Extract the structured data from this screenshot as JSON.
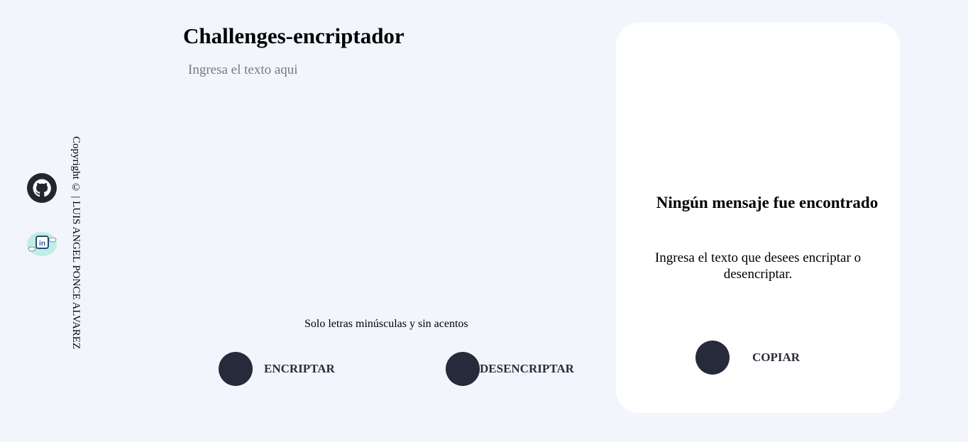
{
  "app": {
    "title": "Challenges-encriptador"
  },
  "sidebar": {
    "github_icon": "github-icon",
    "linkedin_icon": "linkedin-icon",
    "copyright": "Copyright © | LUIS ANGEL PONCE ALVAREZ"
  },
  "main": {
    "input_placeholder": "Ingresa el texto aqui",
    "input_value": "",
    "hint": "Solo letras minúsculas y sin acentos",
    "encrypt_label": "ENCRIPTAR",
    "decrypt_label": "DESENCRIPTAR"
  },
  "result": {
    "title": "Ningún mensaje fue encontrado",
    "message": "Ingresa el texto que desees encriptar o desencriptar.",
    "copy_label": "COPIAR"
  },
  "colors": {
    "background": "#f2f5fc",
    "button_dark": "#272a3a",
    "card": "#ffffff"
  }
}
